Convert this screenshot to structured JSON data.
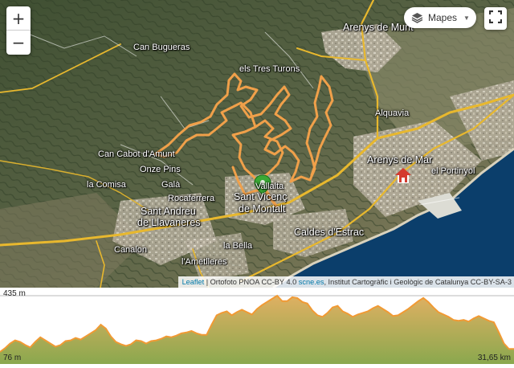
{
  "map": {
    "controls": {
      "zoom_in": "+",
      "zoom_out": "−"
    },
    "layers_button": {
      "label": "Mapes",
      "icon": "layers-icon"
    },
    "fullscreen_button": {
      "icon": "fullscreen-icon"
    },
    "labels": [
      {
        "id": "arenys-de-munt",
        "text": "Arenys de Munt",
        "size": "big"
      },
      {
        "id": "can-bugueras",
        "text": "Can Bugueras"
      },
      {
        "id": "els-tres-turons",
        "text": "els Tres Turons"
      },
      {
        "id": "alquavia",
        "text": "Alquavia"
      },
      {
        "id": "can-cabot",
        "text": "Can Cabot d'Amunt"
      },
      {
        "id": "onze-pins",
        "text": "Onze Pins"
      },
      {
        "id": "arenys-de-mar",
        "text": "Arenys de Mar",
        "size": "big"
      },
      {
        "id": "el-portinyol",
        "text": "el Portinyol"
      },
      {
        "id": "la-comisa",
        "text": "la Comisa"
      },
      {
        "id": "gala",
        "text": "Galà"
      },
      {
        "id": "rocaferrera",
        "text": "Rocaferrera"
      },
      {
        "id": "vallalta",
        "text": "Vallalta"
      },
      {
        "id": "sant-vicenc-1",
        "text": "Sant Vicenç",
        "size": "big"
      },
      {
        "id": "sant-vicenc-2",
        "text": "de Montalt",
        "size": "big"
      },
      {
        "id": "sant-andreu-1",
        "text": "Sant Andreu",
        "size": "big"
      },
      {
        "id": "sant-andreu-2",
        "text": "de Llavaneres",
        "size": "big"
      },
      {
        "id": "caldes",
        "text": "Caldes d'Estrac",
        "size": "big"
      },
      {
        "id": "canaion",
        "text": "Canalon"
      },
      {
        "id": "la-bella",
        "text": "la Bella"
      },
      {
        "id": "ametlleres",
        "text": "l'Ametlleres"
      }
    ],
    "attribution": {
      "leaflet": "Leaflet",
      "sep1": " | Ortofoto PNOA CC-BY 4.0 ",
      "scne": "scne.es",
      "rest": ", Institut Cartogràfic i Geològic de Catalunya CC-BY-SA-3"
    },
    "colors": {
      "track": "#f0a04a",
      "road": "#e8b82e",
      "sea": "#0b3e6b",
      "marker": "#3aa935"
    }
  },
  "profile": {
    "max_label": "435 m",
    "min_label": "76 m",
    "distance_label": "31,65 km",
    "min_elevation_m": 76,
    "max_elevation_m": 435,
    "distance_km": 31.65,
    "elevations_m": [
      76,
      100,
      130,
      150,
      140,
      120,
      105,
      140,
      170,
      150,
      130,
      110,
      120,
      145,
      150,
      165,
      155,
      175,
      195,
      215,
      250,
      225,
      175,
      140,
      125,
      115,
      125,
      150,
      145,
      130,
      145,
      150,
      160,
      175,
      170,
      180,
      195,
      200,
      210,
      195,
      185,
      185,
      250,
      310,
      325,
      335,
      310,
      330,
      345,
      330,
      315,
      350,
      375,
      395,
      415,
      435,
      400,
      400,
      425,
      420,
      395,
      385,
      340,
      310,
      300,
      325,
      360,
      370,
      335,
      320,
      300,
      315,
      325,
      335,
      355,
      370,
      350,
      330,
      305,
      310,
      330,
      350,
      375,
      400,
      420,
      395,
      360,
      330,
      315,
      300,
      280,
      275,
      280,
      270,
      290,
      305,
      290,
      275,
      265,
      200,
      130,
      95,
      95
    ],
    "colors": {
      "fill_top": "#e0b062",
      "fill_bottom": "#8aa84e",
      "line": "#f19a34"
    }
  }
}
